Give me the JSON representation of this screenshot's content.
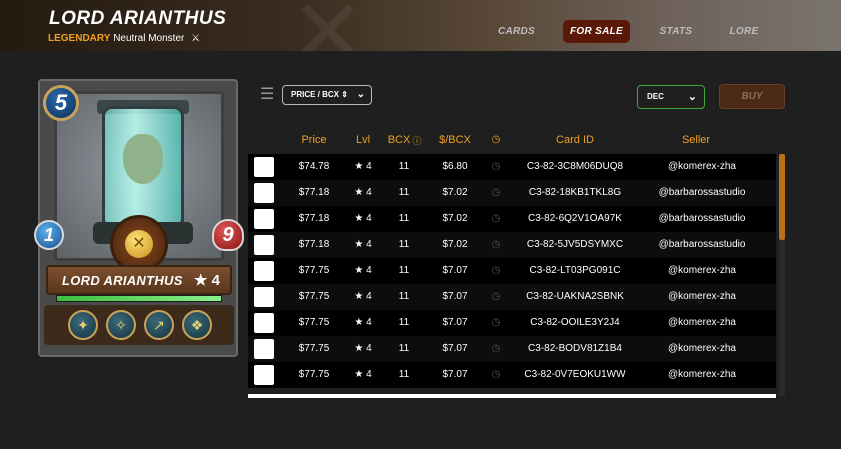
{
  "header": {
    "title": "LORD ARIANTHUS",
    "rarity": "LEGENDARY",
    "type": "Neutral Monster",
    "nav": [
      {
        "label": "CARDS",
        "active": false
      },
      {
        "label": "FOR SALE",
        "active": true
      },
      {
        "label": "STATS",
        "active": false
      },
      {
        "label": "LORE",
        "active": false
      }
    ]
  },
  "card": {
    "mana": "5",
    "attack": "1",
    "health": "9",
    "name": "LORD ARIANTHUS",
    "level": "★ 4",
    "xp_fraction": 1.0
  },
  "filters": {
    "sort_label": "PRICE / BCX ⇕",
    "direction": "DEC",
    "buy_label": "BUY"
  },
  "table": {
    "headers": {
      "price": "Price",
      "lvl": "Lvl",
      "bcx": "BCX",
      "per_bcx": "$/BCX",
      "card_id": "Card ID",
      "seller": "Seller"
    },
    "rows": [
      {
        "price": "$74.78",
        "lvl": "★ 4",
        "bcx": "11",
        "per_bcx": "$6.80",
        "card_id": "C3-82-3C8M06DUQ8",
        "seller": "@komerex-zha"
      },
      {
        "price": "$77.18",
        "lvl": "★ 4",
        "bcx": "11",
        "per_bcx": "$7.02",
        "card_id": "C3-82-18KB1TKL8G",
        "seller": "@barbarossastudio"
      },
      {
        "price": "$77.18",
        "lvl": "★ 4",
        "bcx": "11",
        "per_bcx": "$7.02",
        "card_id": "C3-82-6Q2V1OA97K",
        "seller": "@barbarossastudio"
      },
      {
        "price": "$77.18",
        "lvl": "★ 4",
        "bcx": "11",
        "per_bcx": "$7.02",
        "card_id": "C3-82-5JV5DSYMXC",
        "seller": "@barbarossastudio"
      },
      {
        "price": "$77.75",
        "lvl": "★ 4",
        "bcx": "11",
        "per_bcx": "$7.07",
        "card_id": "C3-82-LT03PG091C",
        "seller": "@komerex-zha"
      },
      {
        "price": "$77.75",
        "lvl": "★ 4",
        "bcx": "11",
        "per_bcx": "$7.07",
        "card_id": "C3-82-UAKNA2SBNK",
        "seller": "@komerex-zha"
      },
      {
        "price": "$77.75",
        "lvl": "★ 4",
        "bcx": "11",
        "per_bcx": "$7.07",
        "card_id": "C3-82-OOILE3Y2J4",
        "seller": "@komerex-zha"
      },
      {
        "price": "$77.75",
        "lvl": "★ 4",
        "bcx": "11",
        "per_bcx": "$7.07",
        "card_id": "C3-82-BODV81Z1B4",
        "seller": "@komerex-zha"
      },
      {
        "price": "$77.75",
        "lvl": "★ 4",
        "bcx": "11",
        "per_bcx": "$7.07",
        "card_id": "C3-82-0V7EOKU1WW",
        "seller": "@komerex-zha"
      }
    ]
  },
  "colors": {
    "accent": "#f0a020",
    "active_tab": "#5a1808",
    "scroll": "#b8731a"
  }
}
